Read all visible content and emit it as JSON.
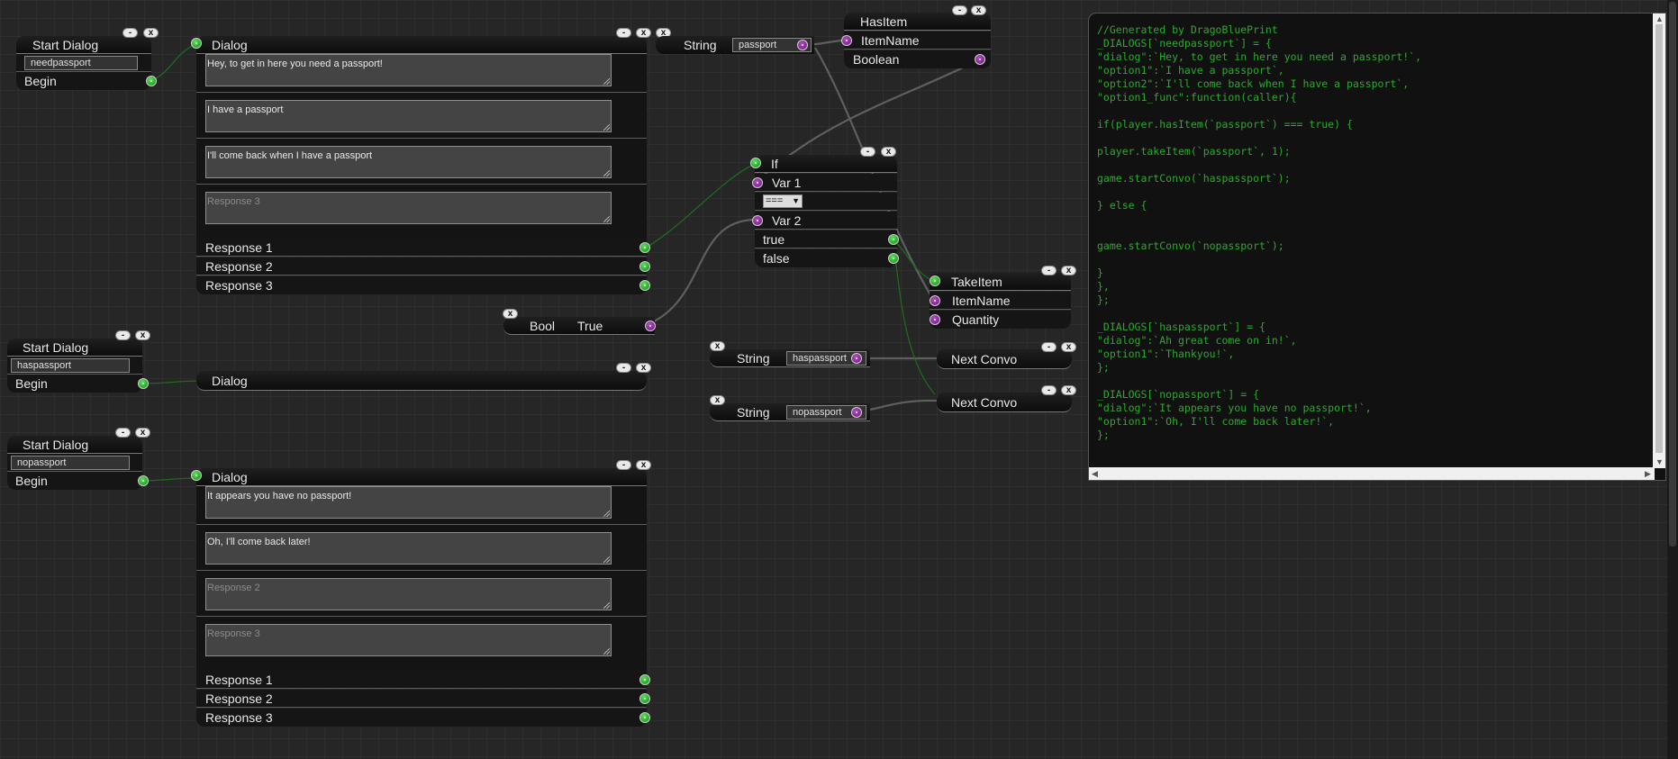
{
  "nodes": {
    "start1": {
      "title": "Start Dialog",
      "name_value": "needpassport",
      "begin_label": "Begin"
    },
    "start2": {
      "title": "Start Dialog",
      "name_value": "haspassport",
      "begin_label": "Begin"
    },
    "start3": {
      "title": "Start Dialog",
      "name_value": "nopassport",
      "begin_label": "Begin"
    },
    "dialog1": {
      "title": "Dialog",
      "text": "Hey, to get in here you need a passport!",
      "option1": "I have a passport",
      "option2": "I'll come back when I have a passport",
      "option3_placeholder": "Response 3",
      "responses": [
        "Response 1",
        "Response 2",
        "Response 3"
      ]
    },
    "dialog2": {
      "title": "Dialog"
    },
    "dialog3": {
      "title": "Dialog",
      "text": "It appears you have no passport!",
      "option1": "Oh, I'll come back later!",
      "option2_placeholder": "Response 2",
      "option3_placeholder": "Response 3",
      "responses": [
        "Response 1",
        "Response 2",
        "Response 3"
      ]
    },
    "string_passport": {
      "label": "String",
      "value": "passport"
    },
    "hasitem": {
      "title": "HasItem",
      "input": "ItemName",
      "output": "Boolean"
    },
    "if": {
      "title": "If",
      "var1": "Var 1",
      "operator": "===",
      "var2": "Var 2",
      "true_label": "true",
      "false_label": "false"
    },
    "bool": {
      "label": "Bool",
      "value": "True"
    },
    "takeitem": {
      "title": "TakeItem",
      "input1": "ItemName",
      "input2": "Quantity"
    },
    "string_has": {
      "label": "String",
      "value": "haspassport"
    },
    "string_no": {
      "label": "String",
      "value": "nopassport"
    },
    "nextconvo1": {
      "title": "Next Convo"
    },
    "nextconvo2": {
      "title": "Next Convo"
    }
  },
  "buttons": {
    "min": "-",
    "close": "x"
  },
  "code": "//Generated by DragoBluePrint\n_DIALOGS[`needpassport`] = {\n\"dialog\":`Hey, to get in here you need a passport!`,\n\"option1\":`I have a passport`,\n\"option2\":`I'll come back when I have a passport`,\n\"option1_func\":function(caller){\n\nif(player.hasItem(`passport`) === true) {\n\nplayer.takeItem(`passport`, 1);\n\ngame.startConvo(`haspassport`);\n\n} else {\n\n\ngame.startConvo(`nopassport`);\n\n}\n},\n};\n\n_DIALOGS[`haspassport`] = {\n\"dialog\":`Ah great come on in!`,\n\"option1\":`Thankyou!`,\n};\n\n_DIALOGS[`nopassport`] = {\n\"dialog\":`It appears you have no passport!`,\n\"option1\":`Oh, I'll come back later!`,\n};",
  "colors": {
    "exec_pin": "#1fa51f",
    "data_pin": "#8a2aa0",
    "code_text": "#2fa82f",
    "background": "#262626"
  }
}
